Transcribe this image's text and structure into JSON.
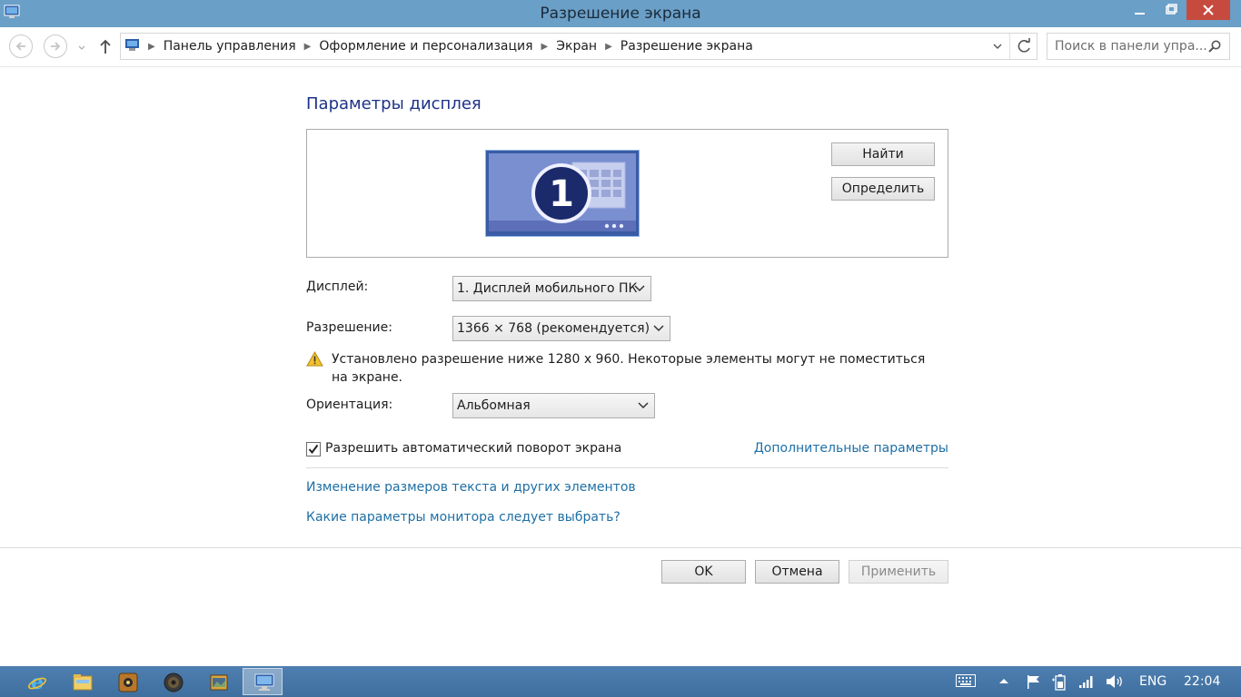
{
  "window": {
    "title": "Разрешение экрана"
  },
  "address": {
    "crumbs": [
      "Панель управления",
      "Оформление и персонализация",
      "Экран",
      "Разрешение экрана"
    ],
    "search_placeholder": "Поиск в панели упра..."
  },
  "main": {
    "heading": "Параметры дисплея",
    "monitor_number": "1",
    "find_label": "Найти",
    "identify_label": "Определить",
    "display_label": "Дисплей:",
    "display_value": "1. Дисплей мобильного ПК",
    "resolution_label": "Разрешение:",
    "resolution_value": "1366 × 768 (рекомендуется)",
    "warning": "Установлено разрешение ниже 1280 x 960. Некоторые элементы могут не поместиться на экране.",
    "orientation_label": "Ориентация:",
    "orientation_value": "Альбомная",
    "auto_rotate_label": "Разрешить автоматический поворот экрана",
    "auto_rotate_checked": true,
    "advanced_link": "Дополнительные параметры",
    "text_size_link": "Изменение размеров текста и других элементов",
    "monitor_help_link": "Какие параметры монитора следует выбрать?"
  },
  "footer": {
    "ok_label": "OK",
    "cancel_label": "Отмена",
    "apply_label": "Применить"
  },
  "taskbar": {
    "pinned": [
      "internet-explorer-icon",
      "file-explorer-icon",
      "media-app-icon",
      "speaker-app-icon",
      "photo-app-icon",
      "display-settings-icon"
    ],
    "language": "ENG",
    "clock": "22:04"
  },
  "colors": {
    "titlebar": "#6a9fc7",
    "close": "#c74a3e",
    "link": "#1e6fa5",
    "heading": "#1e3287",
    "taskbar": "#4577a8"
  }
}
